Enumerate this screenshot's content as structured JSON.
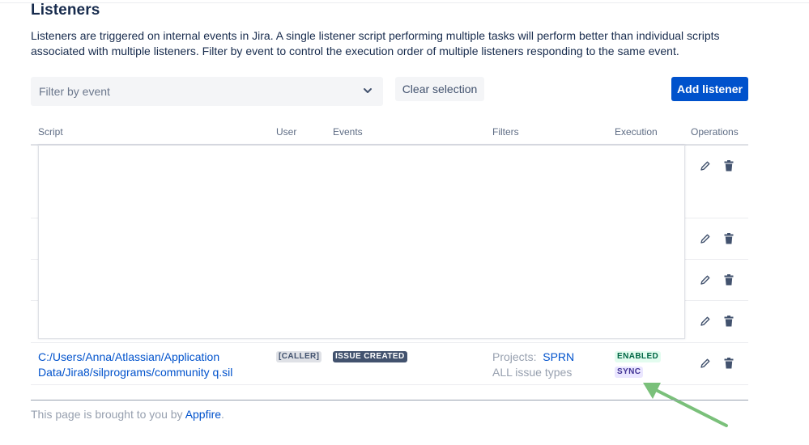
{
  "page": {
    "title": "Listeners",
    "description": "Listeners are triggered on internal events in Jira. A single listener script performing multiple tasks will perform better than individual scripts associated with multiple listeners. Filter by event to control the execution order of multiple listeners responding to the same event."
  },
  "toolbar": {
    "filter_placeholder": "Filter by event",
    "clear_label": "Clear selection",
    "add_label": "Add listener"
  },
  "table": {
    "columns": [
      "Script",
      "User",
      "Events",
      "Filters",
      "Execution",
      "Operations"
    ]
  },
  "listener": {
    "script_line1": "C:/Users/Anna/Atlassian/Application",
    "script_line2": "Data/Jira8/silprograms/community q.sil",
    "user": "[CALLER]",
    "event": "ISSUE CREATED",
    "filter_projects_label": "Projects:",
    "filter_projects_value": "SPRN",
    "filter_issue_types": "ALL issue types",
    "status": "ENABLED",
    "mode": "SYNC"
  },
  "footer": {
    "prefix": "This page is brought to you by ",
    "brand": "Appfire",
    "suffix": "."
  },
  "colors": {
    "primary": "#0052cc",
    "enabled_bg": "#e3fcef",
    "sync_bg": "#eae6ff",
    "arrow": "#7ac07a"
  }
}
